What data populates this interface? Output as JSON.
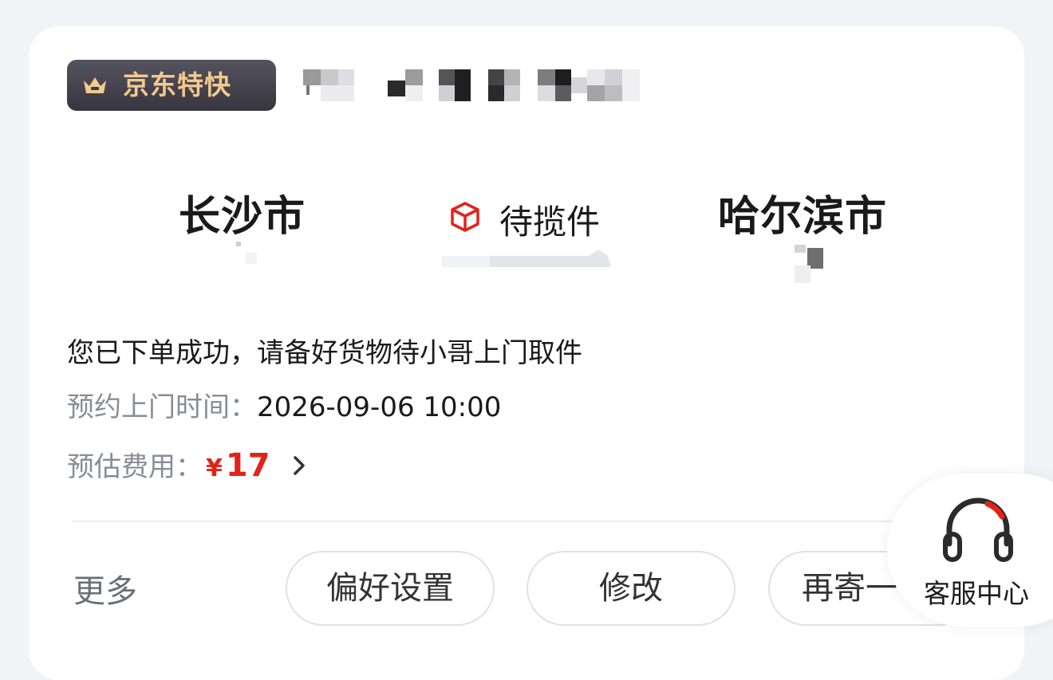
{
  "order": {
    "brand_label": "京东特快",
    "origin_city": "长沙市",
    "destination_city": "哈尔滨市",
    "status": "待揽件",
    "message": "您已下单成功，请备好货物待小哥上门取件",
    "appointment": {
      "label": "预约上门时间：",
      "value": "2026-09-06 10:00"
    },
    "fee": {
      "label": "预估费用：",
      "currency": "¥",
      "amount": "17"
    }
  },
  "actions": {
    "more_label": "更多",
    "preference_label": "偏好设置",
    "edit_label": "修改",
    "resend_label": "再寄一"
  },
  "service": {
    "label": "客服中心"
  },
  "icons": {
    "brand": "crown-icon",
    "status": "package-box-icon",
    "fee_detail": "chevron-right-icon",
    "service": "headset-icon"
  },
  "colors": {
    "accent_red": "#e2231a",
    "brand_gold": "#f2c98f",
    "badge_dark": "#3d3c45"
  }
}
